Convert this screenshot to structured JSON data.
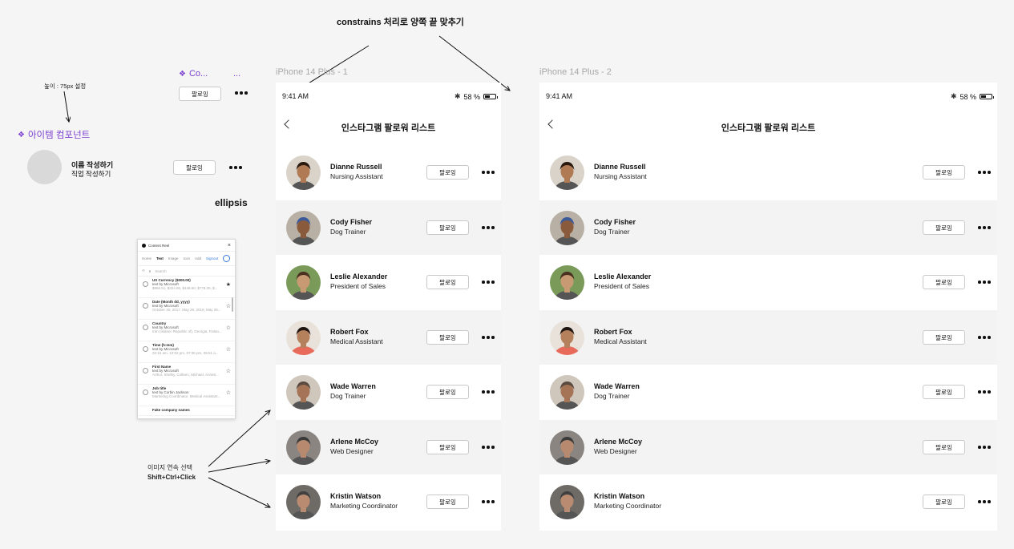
{
  "annotations": {
    "constrains": "constrains 처리로 양쪽 끝 맞추기",
    "height_note": "높이 : 75px 설정",
    "ellipsis": "ellipsis",
    "multi_select_line1": "이미지 연속 선택",
    "multi_select_line2": "Shift+Ctrl+Click"
  },
  "components": {
    "co_label": "Co...",
    "co_more": "...",
    "item_component_label": "아이템 컴포넌트",
    "item_name": "이름 작성하기",
    "item_job": "직업 작성하기",
    "follow_label": "팔로잉"
  },
  "frames": [
    {
      "label": "iPhone 14 Plus - 1",
      "time": "9:41 AM",
      "battery": "58 %",
      "title": "인스타그램 팔로워 리스트"
    },
    {
      "label": "iPhone 14 Plus - 2",
      "time": "9:41 AM",
      "battery": "58 %",
      "title": "인스타그램 팔로워 리스트"
    }
  ],
  "followers": [
    {
      "name": "Dianne Russell",
      "job": "Nursing Assistant",
      "follow": "팔로잉",
      "skin": "#b07a55",
      "hair": "#2a1a10",
      "bg": "#d9d3c9"
    },
    {
      "name": "Cody Fisher",
      "job": "Dog Trainer",
      "follow": "팔로잉",
      "skin": "#8a5a3c",
      "hair": "#3b5a9a",
      "bg": "#b8b0a4"
    },
    {
      "name": "Leslie Alexander",
      "job": "President of Sales",
      "follow": "팔로잉",
      "skin": "#c79a74",
      "hair": "#4a3020",
      "bg": "#7a9a5a"
    },
    {
      "name": "Robert Fox",
      "job": "Medical Assistant",
      "follow": "팔로잉",
      "skin": "#b5805c",
      "hair": "#1e1410",
      "bg": "#e8e2da"
    },
    {
      "name": "Wade Warren",
      "job": "Dog Trainer",
      "follow": "팔로잉",
      "skin": "#a57355",
      "hair": "#5a4a40",
      "bg": "#cfc6bc"
    },
    {
      "name": "Arlene McCoy",
      "job": "Web Designer",
      "follow": "팔로잉",
      "skin": "#b78a70",
      "hair": "#3a3a3a",
      "bg": "#8a8580"
    },
    {
      "name": "Kristin Watson",
      "job": "Marketing Coordinator",
      "follow": "팔로잉",
      "skin": "#b98c72",
      "hair": "#404040",
      "bg": "#6e6a66"
    }
  ],
  "plugin": {
    "title": "Content Reel",
    "tabs": [
      "Home",
      "Text",
      "Image",
      "Icon",
      "Add",
      "Signout"
    ],
    "search_placeholder": "Search",
    "items": [
      {
        "title": "US Currency ($000.00)",
        "by": "text by Microsoft",
        "example": "$965.51, $324.95, $448.60, $778.35, $..."
      },
      {
        "title": "Date (Month dd, yyyy)",
        "by": "text by Microsoft",
        "example": "October 30, 2017, May 29, 2019, May 26..."
      },
      {
        "title": "Country",
        "by": "text by Microsoft",
        "example": "Iran (Islamic Republic of), Georgia, Finlan..."
      },
      {
        "title": "Time (h:mm)",
        "by": "text by Microsoft",
        "example": "02:16 am, 10:02 pm, 07:36 pm, 05:51 a..."
      },
      {
        "title": "First Name",
        "by": "text by Microsoft",
        "example": "Arthur, Shelby, Colleen, Michael, Annett..."
      },
      {
        "title": "Job title",
        "by": "text by Corbin Jackson",
        "example": "Marketing Coordinator, Medical Assistant..."
      }
    ],
    "partial_item": "Fake company names"
  }
}
